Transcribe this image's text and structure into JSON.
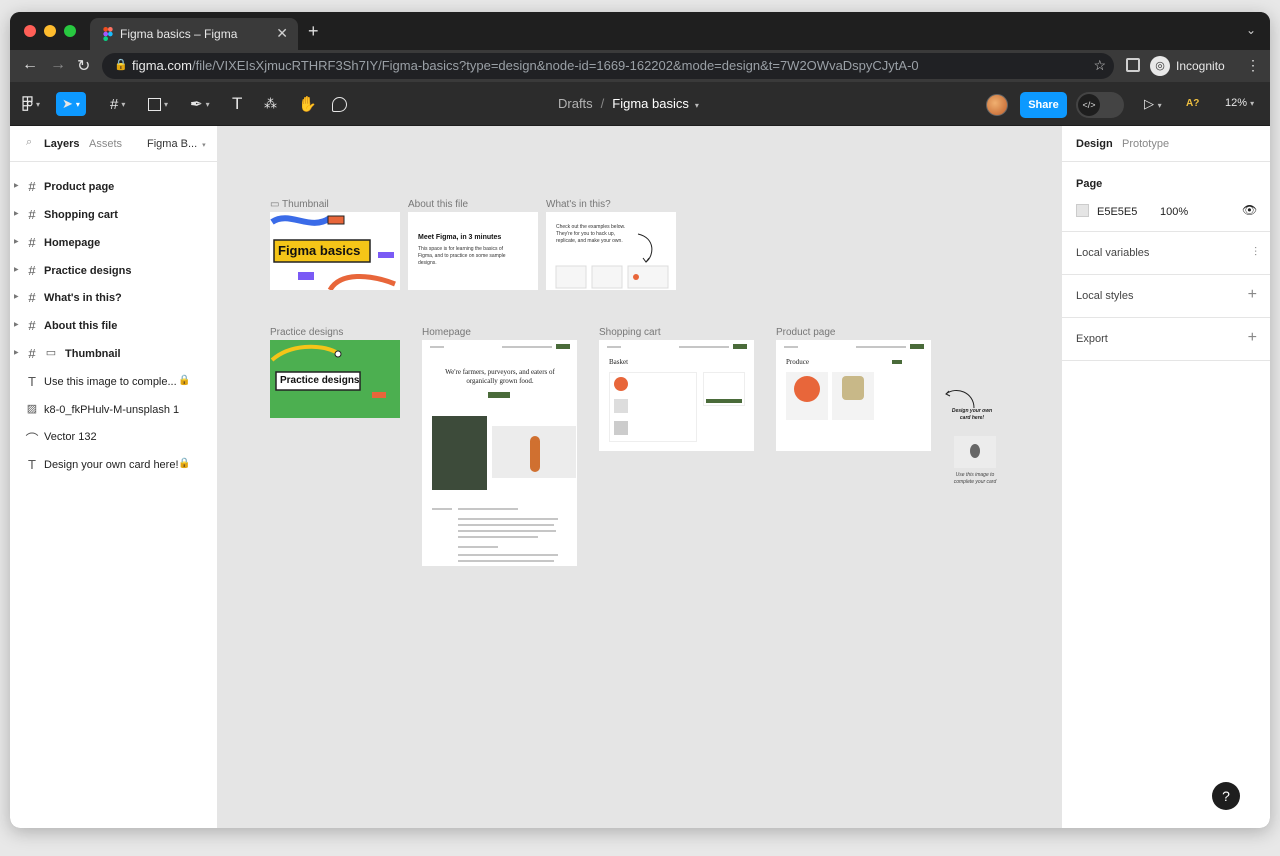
{
  "browser": {
    "tab_title": "Figma basics – Figma",
    "url_host": "figma.com",
    "url_path": "/file/VIXEIsXjmucRTHRF3Sh7IY/Figma-basics?type=design&node-id=1669-162202&mode=design&t=7W2OWvaDspyCJytA-0",
    "profile_label": "Incognito"
  },
  "toolbar": {
    "breadcrumb_parent": "Drafts",
    "file_name": "Figma basics",
    "share_label": "Share",
    "a11y_label": "A?",
    "zoom_label": "12%"
  },
  "left_panel": {
    "tab_layers": "Layers",
    "tab_assets": "Assets",
    "page_selector": "Figma B...",
    "layers": [
      {
        "name": "Product page",
        "type": "frame",
        "locked": false
      },
      {
        "name": "Shopping cart",
        "type": "frame",
        "locked": false
      },
      {
        "name": "Homepage",
        "type": "frame",
        "locked": false
      },
      {
        "name": "Practice designs",
        "type": "frame",
        "locked": false
      },
      {
        "name": "What's in this?",
        "type": "frame",
        "locked": false
      },
      {
        "name": "About this file",
        "type": "frame",
        "locked": false
      },
      {
        "name": "Thumbnail",
        "type": "frame",
        "locked": false
      },
      {
        "name": "Use this image to comple...",
        "type": "text",
        "locked": true
      },
      {
        "name": "k8-0_fkPHulv-M-unsplash 1",
        "type": "image",
        "locked": false
      },
      {
        "name": "Vector 132",
        "type": "vector",
        "locked": false
      },
      {
        "name": "Design your own card here!",
        "type": "text",
        "locked": true
      }
    ]
  },
  "right_panel": {
    "tab_design": "Design",
    "tab_prototype": "Prototype",
    "page_heading": "Page",
    "page_color_hex": "E5E5E5",
    "page_opacity": "100%",
    "local_variables": "Local variables",
    "local_styles": "Local styles",
    "export": "Export"
  },
  "canvas": {
    "frames": {
      "thumbnail": {
        "label": "Thumbnail",
        "title": "Figma basics"
      },
      "about": {
        "label": "About this file",
        "heading": "Meet Figma, in 3 minutes",
        "body": "This space is for learning the basics of Figma, and to practice on some sample designs."
      },
      "whats_in": {
        "label": "What's in this?",
        "body": "Check out the examples below. They're for you to hack up, replicate, and make your own."
      },
      "practice": {
        "label": "Practice designs",
        "title": "Practice designs"
      },
      "homepage": {
        "label": "Homepage",
        "headline": "We're farmers, purveyors, and eaters of organically grown food."
      },
      "cart": {
        "label": "Shopping cart",
        "heading": "Basket"
      },
      "product": {
        "label": "Product page",
        "heading": "Produce"
      }
    },
    "annotation_top": "Design your own card here!",
    "annotation_bottom": "Use this image to complete your card"
  },
  "colors": {
    "accent": "#0d99ff",
    "practice_green": "#4caf50",
    "brand_yellow": "#f5c518"
  }
}
